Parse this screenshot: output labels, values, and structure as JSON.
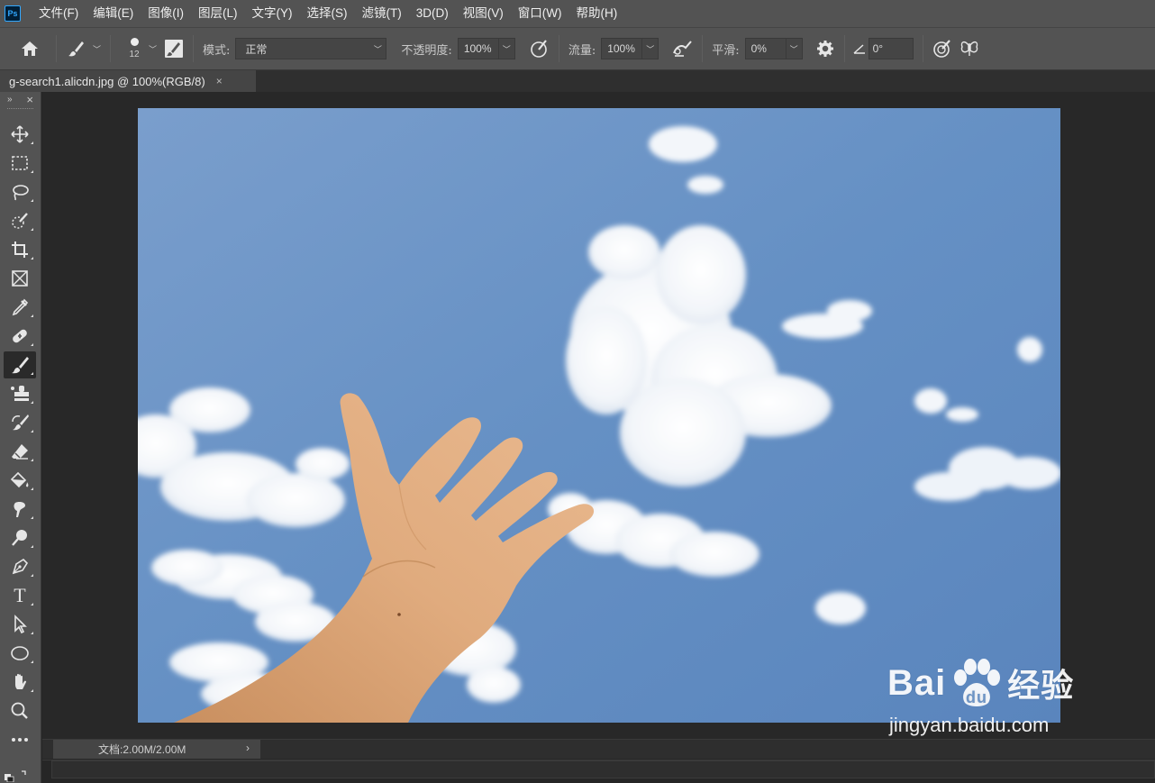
{
  "app": {
    "logo": "Ps"
  },
  "menu": [
    "文件(F)",
    "编辑(E)",
    "图像(I)",
    "图层(L)",
    "文字(Y)",
    "选择(S)",
    "滤镜(T)",
    "3D(D)",
    "视图(V)",
    "窗口(W)",
    "帮助(H)"
  ],
  "options": {
    "brush_size": "12",
    "mode_label": "模式:",
    "mode_value": "正常",
    "opacity_label": "不透明度:",
    "opacity_value": "100%",
    "flow_label": "流量:",
    "flow_value": "100%",
    "smoothing_label": "平滑:",
    "smoothing_value": "0%",
    "angle_value": "0°"
  },
  "document": {
    "tab_title": "g-search1.alicdn.jpg @ 100%(RGB/8)",
    "close": "×"
  },
  "toolbar": {
    "collapse": "»",
    "close": "×",
    "tools": [
      {
        "name": "move-tool",
        "icon": "move-icon"
      },
      {
        "name": "marquee-tool",
        "icon": "rect-marquee-icon"
      },
      {
        "name": "lasso-tool",
        "icon": "lasso-icon"
      },
      {
        "name": "quick-select-tool",
        "icon": "quick-select-icon"
      },
      {
        "name": "crop-tool",
        "icon": "crop-icon"
      },
      {
        "name": "frame-tool",
        "icon": "frame-icon"
      },
      {
        "name": "eyedropper-tool",
        "icon": "eyedropper-icon"
      },
      {
        "name": "healing-tool",
        "icon": "bandage-icon"
      },
      {
        "name": "brush-tool",
        "icon": "brush-icon",
        "active": true
      },
      {
        "name": "stamp-tool",
        "icon": "stamp-icon"
      },
      {
        "name": "history-brush-tool",
        "icon": "history-brush-icon"
      },
      {
        "name": "eraser-tool",
        "icon": "eraser-icon"
      },
      {
        "name": "paint-bucket-tool",
        "icon": "bucket-icon"
      },
      {
        "name": "smudge-tool",
        "icon": "smudge-icon"
      },
      {
        "name": "dodge-tool",
        "icon": "dodge-icon"
      },
      {
        "name": "pen-tool",
        "icon": "pen-icon"
      },
      {
        "name": "type-tool",
        "icon": "type-icon"
      },
      {
        "name": "path-select-tool",
        "icon": "arrow-icon"
      },
      {
        "name": "ellipse-tool",
        "icon": "ellipse-icon"
      },
      {
        "name": "hand-tool",
        "icon": "hand-icon"
      },
      {
        "name": "zoom-tool",
        "icon": "zoom-icon"
      },
      {
        "name": "more-tools",
        "icon": "more-icon"
      }
    ],
    "type_glyph": "T"
  },
  "status": {
    "doc_info": "文档:2.00M/2.00M",
    "arrow": "›"
  },
  "watermark": {
    "brand_left": "Bai",
    "brand_right": "经验",
    "url": "jingyan.baidu.com"
  },
  "colors": {
    "sky_top": "#6f96c6",
    "sky_bottom": "#5b87bf",
    "skin": "#d9a273",
    "accent": "#31a8ff"
  }
}
